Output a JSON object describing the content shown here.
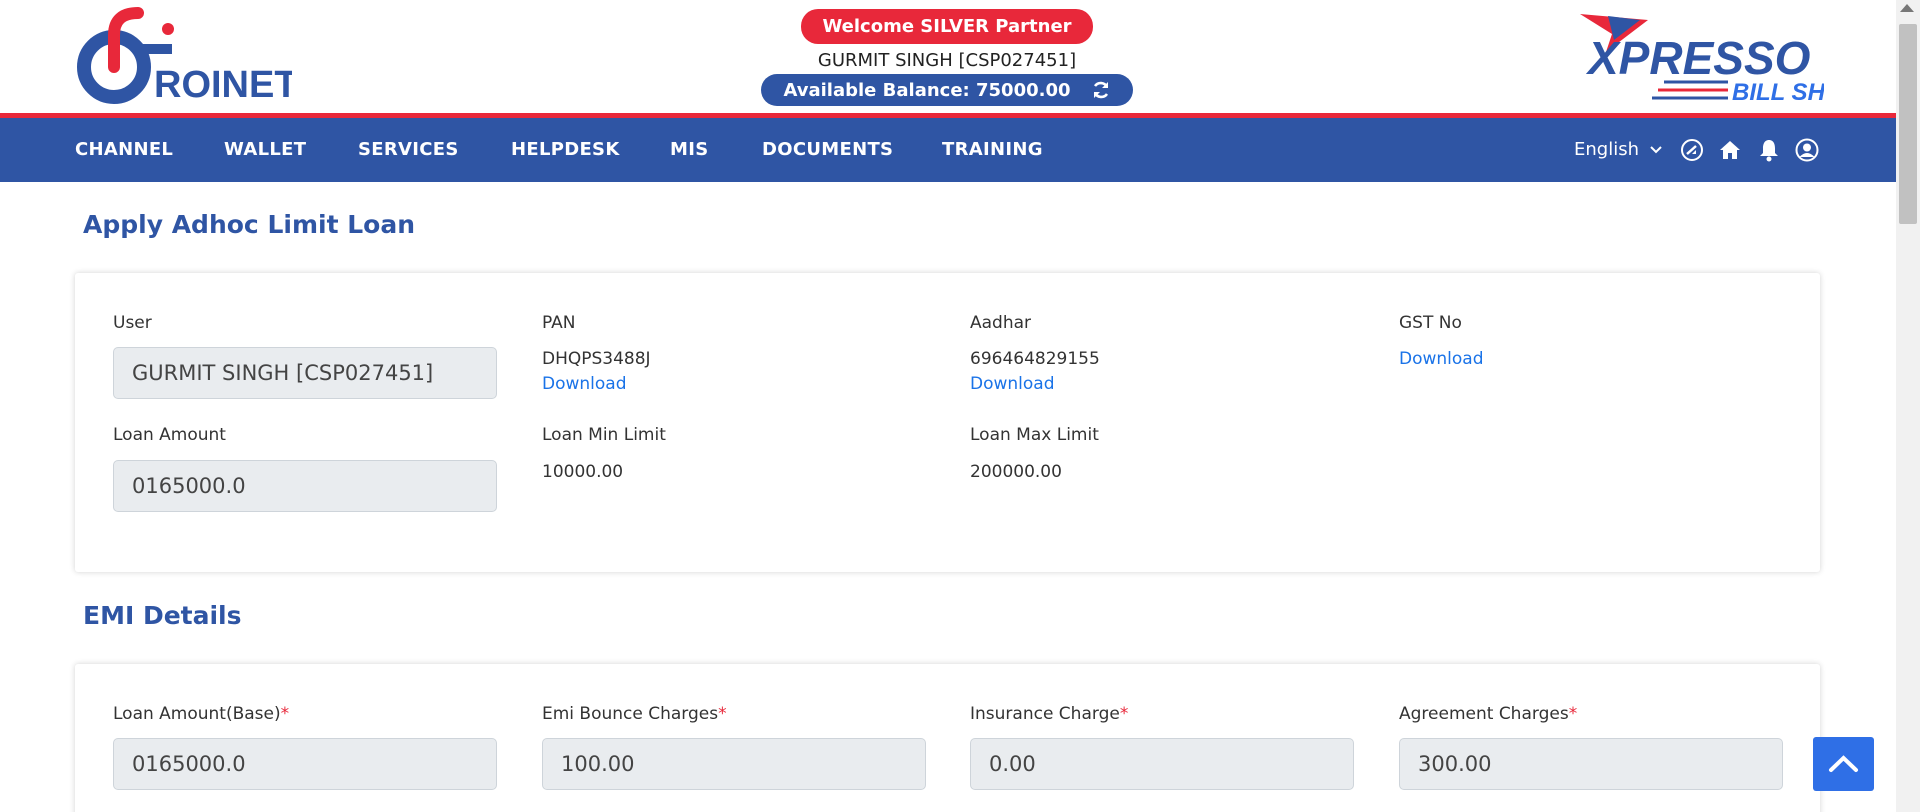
{
  "header": {
    "welcome": "Welcome SILVER Partner",
    "user": "GURMIT SINGH [CSP027451]",
    "balance": "Available Balance: 75000.00",
    "left_logo_text": "ROINET",
    "right_logo_text_1": "XPRESSO",
    "right_logo_text_2": "BILL SHOP"
  },
  "nav": {
    "items": [
      "CHANNEL",
      "WALLET",
      "SERVICES",
      "HELPDESK",
      "MIS",
      "DOCUMENTS",
      "TRAINING"
    ],
    "language": "English",
    "icons": [
      "dashboard-icon",
      "home-icon",
      "bell-icon",
      "user-icon"
    ]
  },
  "loan": {
    "title": "Apply Adhoc Limit Loan",
    "user_label": "User",
    "user_value": "GURMIT SINGH [CSP027451]",
    "pan_label": "PAN",
    "pan_value": "DHQPS3488J",
    "aadhar_label": "Aadhar",
    "aadhar_value": "696464829155",
    "gst_label": "GST No",
    "download": "Download",
    "amount_label": "Loan Amount",
    "amount_value": "0165000.0",
    "min_label": "Loan Min Limit",
    "min_value": "10000.00",
    "max_label": "Loan Max Limit",
    "max_value": "200000.00"
  },
  "emi": {
    "title": "EMI Details",
    "base_label": "Loan Amount(Base)",
    "base_value": "0165000.0",
    "bounce_label": "Emi Bounce Charges",
    "bounce_value": "100.00",
    "insurance_label": "Insurance Charge",
    "insurance_value": "0.00",
    "agreement_label": "Agreement Charges",
    "agreement_value": "300.00",
    "required_mark": "*"
  },
  "colors": {
    "brand_blue": "#2f55a4",
    "brand_red": "#e8283a",
    "link": "#1a73e8"
  }
}
